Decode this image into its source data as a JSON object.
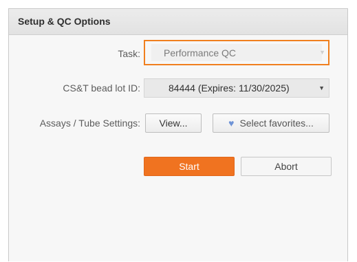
{
  "panel": {
    "title": "Setup & QC Options"
  },
  "form": {
    "task_label": "Task:",
    "task_value": "Performance QC",
    "lot_label": "CS&T bead lot ID:",
    "lot_value": "84444 (Expires: 11/30/2025)",
    "assays_label": "Assays / Tube Settings:",
    "view_button": "View...",
    "favorites_button": "Select favorites..."
  },
  "actions": {
    "start_label": "Start",
    "abort_label": "Abort"
  },
  "icons": {
    "task_dropdown": "chevron-down-icon",
    "lot_dropdown": "chevron-down-icon",
    "favorites": "heart-icon"
  },
  "colors": {
    "accent": "#f07320",
    "highlight_border": "#f07f1e",
    "heart": "#6e93d6"
  }
}
